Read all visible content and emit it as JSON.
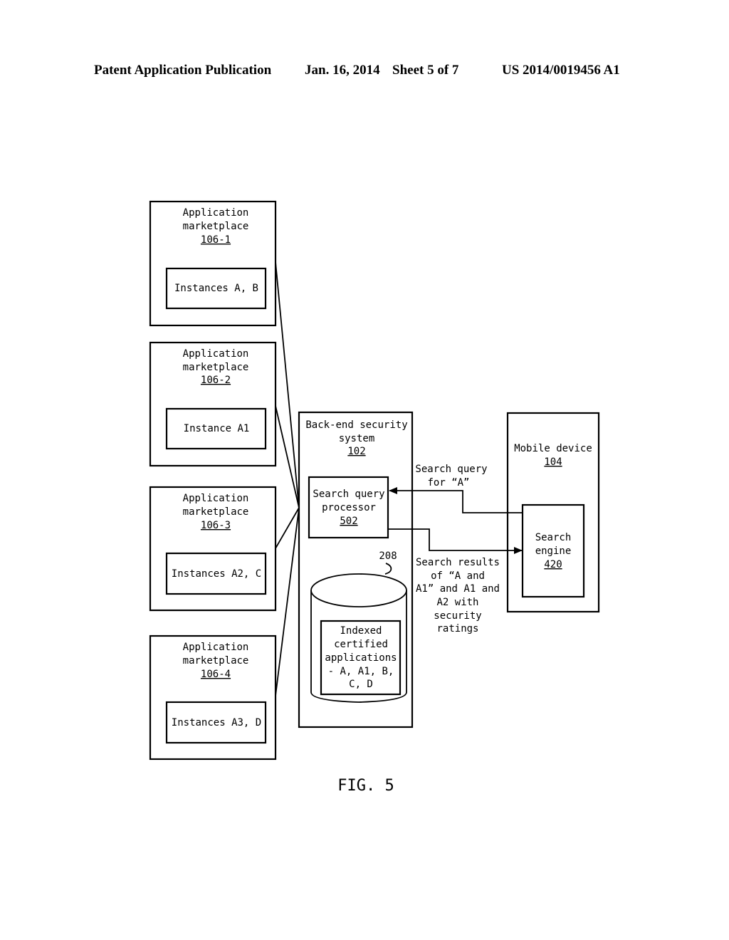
{
  "header": {
    "publication": "Patent Application Publication",
    "date": "Jan. 16, 2014",
    "sheet": "Sheet 5 of 7",
    "number": "US 2014/0019456 A1"
  },
  "marketplaces": [
    {
      "line1": "Application",
      "line2": "marketplace",
      "ref": "106-1",
      "instances": "Instances A, B"
    },
    {
      "line1": "Application",
      "line2": "marketplace",
      "ref": "106-2",
      "instances": "Instance A1"
    },
    {
      "line1": "Application",
      "line2": "marketplace",
      "ref": "106-3",
      "instances": "Instances A2, C"
    },
    {
      "line1": "Application",
      "line2": "marketplace",
      "ref": "106-4",
      "instances": "Instances A3, D"
    }
  ],
  "backend": {
    "line1": "Back-end security",
    "line2": "system",
    "ref": "102",
    "processor": {
      "line1": "Search query",
      "line2": "processor",
      "ref": "502"
    },
    "database": {
      "ref": "208",
      "lines": [
        "Indexed",
        "certified",
        "applications",
        "- A, A1, B,",
        "C, D"
      ]
    }
  },
  "mobile": {
    "line1": "Mobile device",
    "ref": "104",
    "engine": {
      "line1": "Search",
      "line2": "engine",
      "ref": "420"
    }
  },
  "arrows": {
    "query": [
      "Search query",
      "for “A”"
    ],
    "results": [
      "Search results",
      "of “A and",
      "A1” and A1 and",
      "A2 with",
      "security",
      "ratings"
    ]
  },
  "figure_label": "FIG. 5"
}
